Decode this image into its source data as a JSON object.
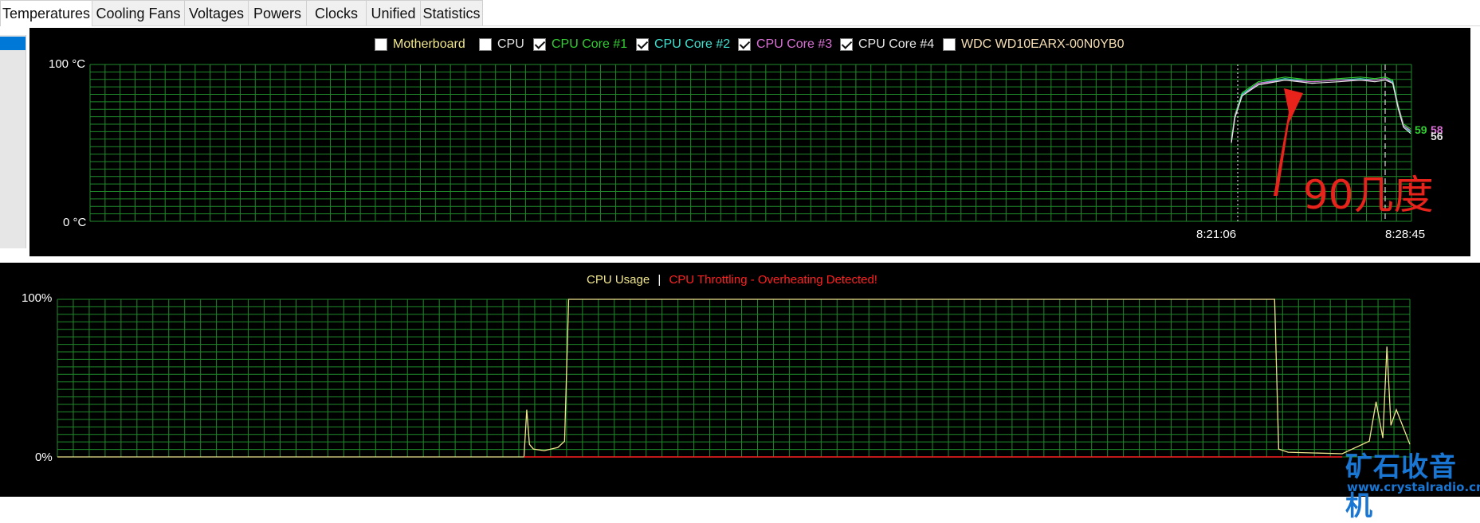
{
  "tabs": [
    {
      "label": "Temperatures",
      "active": true
    },
    {
      "label": "Cooling Fans",
      "active": false
    },
    {
      "label": "Voltages",
      "active": false
    },
    {
      "label": "Powers",
      "active": false
    },
    {
      "label": "Clocks",
      "active": false
    },
    {
      "label": "Unified",
      "active": false
    },
    {
      "label": "Statistics",
      "active": false
    }
  ],
  "temp_chart": {
    "legend": [
      {
        "label": "Motherboard",
        "checked": false,
        "color": "#f0e68c"
      },
      {
        "label": "CPU",
        "checked": false,
        "color": "#e0e0e0"
      },
      {
        "label": "CPU Core #1",
        "checked": true,
        "color": "#32cd32"
      },
      {
        "label": "CPU Core #2",
        "checked": true,
        "color": "#40e0d0"
      },
      {
        "label": "CPU Core #3",
        "checked": true,
        "color": "#da70d6"
      },
      {
        "label": "CPU Core #4",
        "checked": true,
        "color": "#e8e8e8"
      },
      {
        "label": "WDC WD10EARX-00N0YB0",
        "checked": false,
        "color": "#f5deb3"
      }
    ],
    "y_top_label": "100 °C",
    "y_bottom_label": "0 °C",
    "time_labels": [
      "8:21:06",
      "8:28:45"
    ],
    "end_values": [
      {
        "text": "59",
        "color": "#32cd32"
      },
      {
        "text": "58",
        "color": "#da70d6"
      },
      {
        "text": "56",
        "color": "#e8e8e8"
      }
    ],
    "annotation": "90几度",
    "grid_color": "#1f8a2a"
  },
  "usage_chart": {
    "title_usage": "CPU Usage",
    "separator": "|",
    "title_throttle": "CPU Throttling - Overheating Detected!",
    "usage_color": "#f0e68c",
    "throttle_color": "#ff2020",
    "y_top_label": "100%",
    "y_bottom_label": "0%",
    "grid_color": "#1f8a2a"
  },
  "watermark": {
    "title": "矿石收音机",
    "url": "www.crystalradio.cn"
  },
  "chart_data": [
    {
      "type": "line",
      "title": "",
      "ylabel": "°C",
      "ylim": [
        0,
        100
      ],
      "x_labels": [
        "8:21:06",
        "8:28:45"
      ],
      "series": [
        {
          "name": "CPU Core #1",
          "x": [
            0,
            0.02,
            0.06,
            0.15,
            0.3,
            0.45,
            0.6,
            0.72,
            0.8,
            0.86,
            0.9,
            0.93,
            0.96,
            1.0
          ],
          "values": [
            52,
            68,
            82,
            89,
            92,
            90,
            91,
            92,
            91,
            92,
            90,
            74,
            62,
            59
          ]
        },
        {
          "name": "CPU Core #2",
          "x": [
            0,
            0.02,
            0.06,
            0.15,
            0.3,
            0.45,
            0.6,
            0.72,
            0.8,
            0.86,
            0.9,
            0.93,
            0.96,
            1.0
          ],
          "values": [
            51,
            67,
            81,
            88,
            91,
            89,
            90,
            91,
            90,
            91,
            89,
            73,
            61,
            57
          ]
        },
        {
          "name": "CPU Core #3",
          "x": [
            0,
            0.02,
            0.06,
            0.15,
            0.3,
            0.45,
            0.6,
            0.72,
            0.8,
            0.86,
            0.9,
            0.93,
            0.96,
            1.0
          ],
          "values": [
            51,
            67,
            80,
            88,
            90,
            89,
            90,
            90,
            90,
            91,
            88,
            73,
            61,
            58
          ]
        },
        {
          "name": "CPU Core #4",
          "x": [
            0,
            0.02,
            0.06,
            0.15,
            0.3,
            0.45,
            0.6,
            0.72,
            0.8,
            0.86,
            0.9,
            0.93,
            0.96,
            1.0
          ],
          "values": [
            50,
            66,
            80,
            87,
            90,
            88,
            89,
            90,
            89,
            90,
            88,
            72,
            60,
            56
          ]
        }
      ]
    },
    {
      "type": "area",
      "title": "",
      "ylabel": "%",
      "ylim": [
        0,
        100
      ],
      "series": [
        {
          "name": "CPU Usage",
          "x": [
            0,
            0.345,
            0.347,
            0.349,
            0.352,
            0.36,
            0.37,
            0.375,
            0.378,
            0.9,
            0.903,
            0.91,
            0.95,
            0.97,
            0.975,
            0.98,
            0.983,
            0.986,
            0.99,
            1.0
          ],
          "values": [
            0,
            0,
            30,
            8,
            5,
            4,
            6,
            10,
            100,
            100,
            5,
            3,
            2,
            10,
            35,
            12,
            70,
            20,
            30,
            8
          ]
        },
        {
          "name": "CPU Throttling - Overheating Detected!",
          "x": [
            0,
            1
          ],
          "values": [
            0,
            0
          ]
        }
      ]
    }
  ]
}
